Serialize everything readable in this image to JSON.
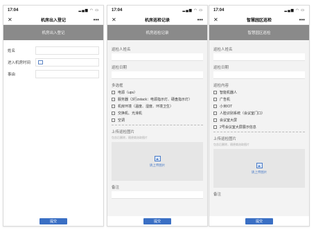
{
  "status_bar": {
    "time": "17:04",
    "icons": "▂▄▆ ◠ ▭"
  },
  "common": {
    "close_icon": "✕",
    "more_icon": "•••",
    "submit_label": "提交",
    "upload_caption": "请上传图片",
    "upload_hint": "包含后删除，随便裁选取图片"
  },
  "phone1": {
    "nav_title": "机房出入登记",
    "banner": "机房出入登记",
    "fields": [
      {
        "label": "姓名"
      },
      {
        "label": "进入机房时间",
        "icon": "calendar-icon"
      },
      {
        "label": "事由"
      }
    ]
  },
  "phone2": {
    "nav_title": "机房巡检记录",
    "banner": "机房巡检记录",
    "inspector_label": "巡检人姓名",
    "date_label": "巡检日期",
    "multi_label": "多选框",
    "options": [
      "电源（ups）",
      "服务器（3行zstack：电源指示灯、硬盘指示灯）",
      "机房环境（温度、湿度、环境卫生）",
      "交换机、光滑机",
      "空调"
    ],
    "photo_label": "上传巡检图片",
    "remarks_label": "备注"
  },
  "phone3": {
    "nav_title": "智慧园区巡检",
    "banner": "智慧园区巡检",
    "inspector_label": "巡检人姓名",
    "date_label": "巡检日期",
    "content_label": "巡检内容",
    "options": [
      "智能机器人",
      "广告机",
      "小米IOT",
      "人脸识别系统（会议室门口）",
      "会议室大屏",
      "2号会议室大屏展示信息"
    ],
    "photo_label": "上传巡检图片",
    "remarks_label": "备注"
  }
}
